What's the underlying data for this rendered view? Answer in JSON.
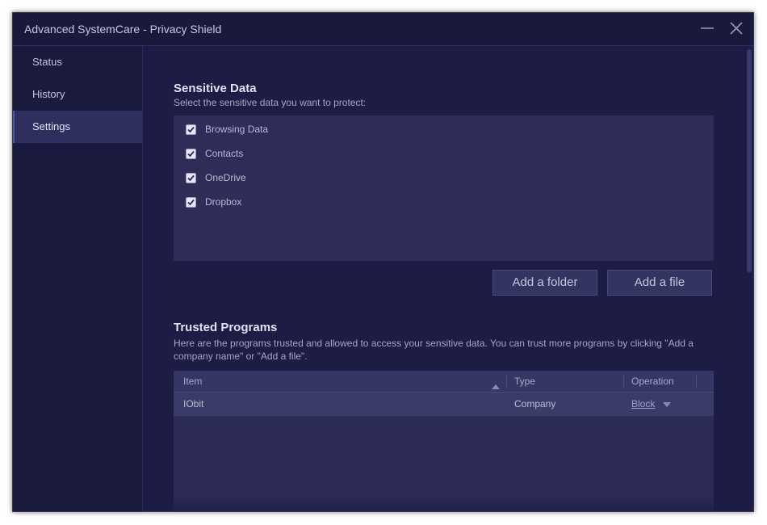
{
  "window": {
    "title": "Advanced SystemCare - Privacy Shield",
    "minimize_icon": "minimize-icon",
    "close_icon": "close-icon"
  },
  "sidebar": {
    "items": [
      {
        "label": "Status"
      },
      {
        "label": "History"
      },
      {
        "label": "Settings",
        "active": true
      }
    ]
  },
  "sensitive": {
    "title": "Sensitive Data",
    "description": "Select the sensitive data you want to protect:",
    "items": [
      {
        "label": "Browsing Data",
        "checked": true
      },
      {
        "label": "Contacts",
        "checked": true
      },
      {
        "label": "OneDrive",
        "checked": true
      },
      {
        "label": "Dropbox",
        "checked": true
      }
    ],
    "add_folder_label": "Add a folder",
    "add_file_label": "Add a file"
  },
  "trusted": {
    "title": "Trusted Programs",
    "description": "Here are the programs trusted and allowed to access your sensitive data. You can trust more programs by clicking \"Add a company name\" or \"Add a file\".",
    "columns": {
      "item": "Item",
      "type": "Type",
      "operation": "Operation"
    },
    "rows": [
      {
        "item": "IObit",
        "type": "Company",
        "operation": "Block"
      }
    ]
  },
  "colors": {
    "background": "#1b1b40",
    "sidebar_active": "#2e2f5f",
    "panel": "#2d2d57",
    "accent_link": "#9ea0d4"
  }
}
